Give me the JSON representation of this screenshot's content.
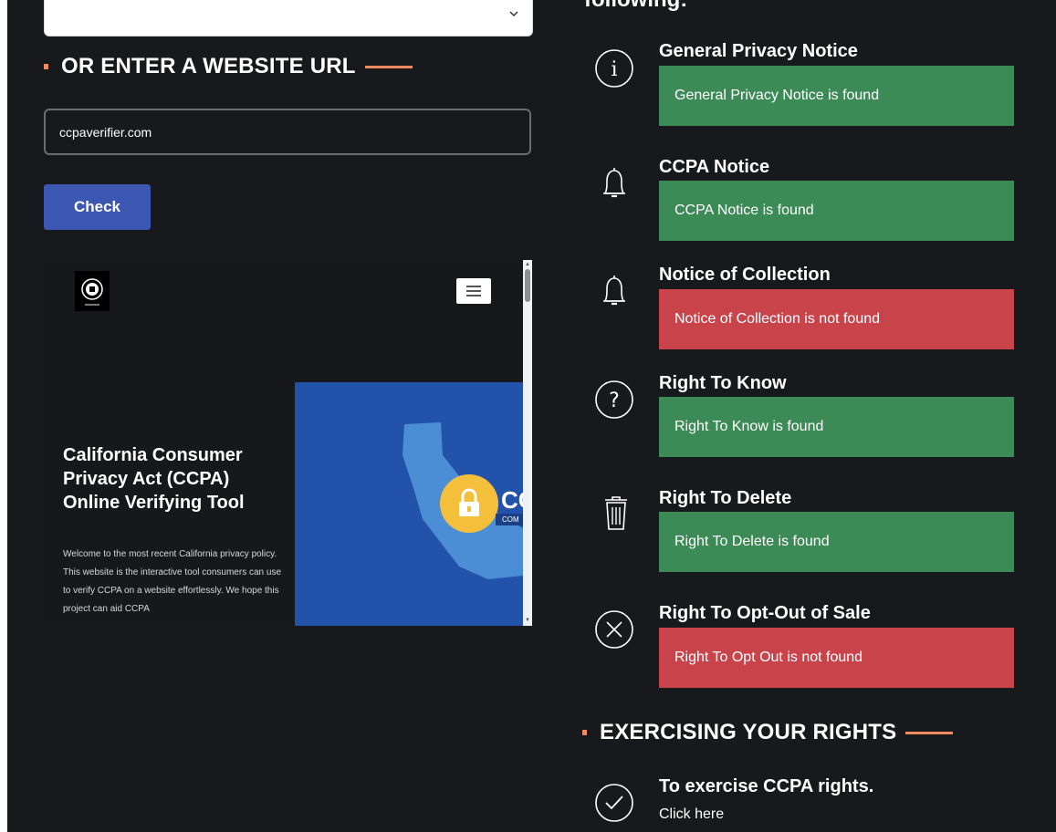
{
  "url_section": {
    "title": "OR ENTER A WEBSITE URL",
    "input_value": "ccpaverifier.com",
    "check_label": "Check"
  },
  "preview": {
    "hero_title": "California Consumer Privacy Act (CCPA) Online Verifying Tool",
    "hero_text": "Welcome to the most recent California privacy policy. This website is the interactive tool consumers can use to verify CCPA on a website effortlessly. We hope this project can aid CCPA",
    "badge_text": "CC",
    "badge_sub": "COM"
  },
  "results_heading": "following:",
  "results": [
    {
      "title": "General Privacy Notice",
      "status": "General Privacy Notice is found",
      "found": true,
      "icon": "info-icon"
    },
    {
      "title": "CCPA Notice",
      "status": "CCPA Notice is found",
      "found": true,
      "icon": "bell-icon"
    },
    {
      "title": "Notice of Collection",
      "status": "Notice of Collection is not found",
      "found": false,
      "icon": "bell-icon"
    },
    {
      "title": "Right To Know",
      "status": "Right To Know is found",
      "found": true,
      "icon": "question-icon"
    },
    {
      "title": "Right To Delete",
      "status": "Right To Delete is found",
      "found": true,
      "icon": "trash-icon"
    },
    {
      "title": "Right To Opt-Out of Sale",
      "status": "Right To Opt Out is not found",
      "found": false,
      "icon": "close-circle-icon"
    }
  ],
  "exercising": {
    "title": "EXERCISING YOUR RIGHTS",
    "item_title": "To exercise CCPA rights.",
    "link_text": "Click here",
    "icon": "check-circle-icon"
  },
  "colors": {
    "background": "#18191d",
    "accent": "#f08a5d",
    "button": "#3b57b1",
    "found": "#3c8a56",
    "not_found": "#c9434b"
  }
}
